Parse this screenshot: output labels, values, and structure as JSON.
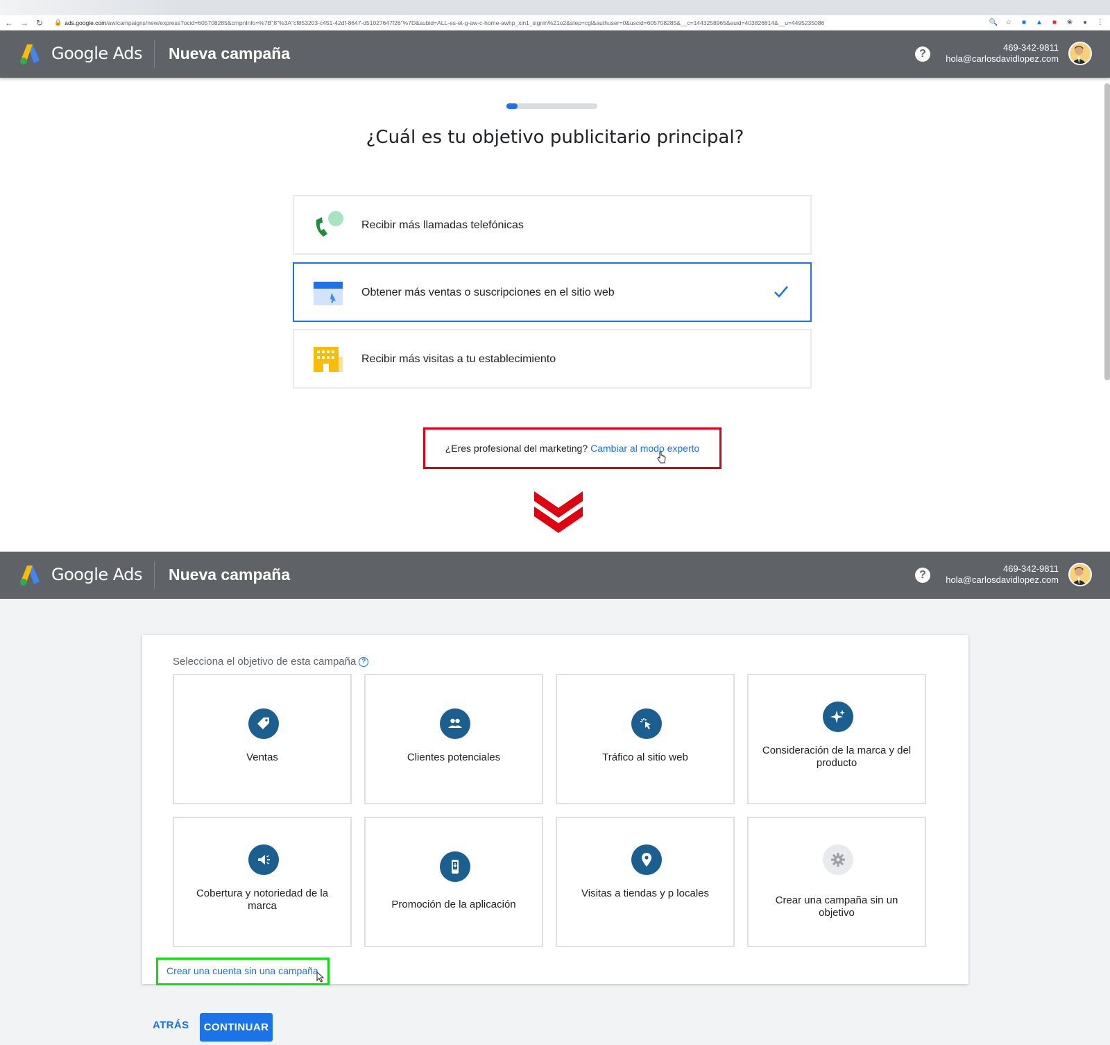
{
  "browser": {
    "url_host": "ads.google.com",
    "url_path": "/aw/campaigns/new/express?ocid=605708285&cmpnInfo=%7B\"8\"%3A\"cf853203-c451-42df-8647-d51027647f26\"%7D&subid=ALL-es-et-g-aw-c-home-awhp_xin1_signin%21o2&step=cgl&authuser=0&uscid=605708285&__c=1443258965&euid=403826814&__u=4495235086"
  },
  "header": {
    "brand": "Google Ads",
    "title": "Nueva campaña",
    "help_icon": "?",
    "phone": "469-342-9811",
    "email": "hola@carlosdavidlopez.com"
  },
  "express": {
    "progress_fraction": 0.12,
    "question": "¿Cuál es tu objetivo publicitario principal?",
    "options": [
      {
        "label": "Recibir más llamadas telefónicas",
        "icon": "phone-icon",
        "selected": false
      },
      {
        "label": "Obtener más ventas o suscripciones en el sitio web",
        "icon": "website-icon",
        "selected": true
      },
      {
        "label": "Recibir más visitas a tu establecimiento",
        "icon": "store-icon",
        "selected": false
      }
    ],
    "expert_question": "¿Eres profesional del marketing?",
    "expert_link": "Cambiar al modo experto"
  },
  "expert": {
    "panel_label": "Selecciona el objetivo de esta campaña",
    "objectives": [
      {
        "label": "Ventas",
        "icon": "tag-icon"
      },
      {
        "label": "Clientes potenciales",
        "icon": "people-icon"
      },
      {
        "label": "Tráfico al sitio web",
        "icon": "cursor-click-icon"
      },
      {
        "label": "Consideración de la marca y del producto",
        "icon": "sparkle-icon"
      },
      {
        "label": "Cobertura y notoriedad de la marca",
        "icon": "megaphone-icon"
      },
      {
        "label": "Promoción de la aplicación",
        "icon": "mobile-app-icon"
      },
      {
        "label": "Visitas a tiendas y p locales",
        "icon": "location-pin-icon"
      },
      {
        "label": "Crear una campaña sin un objetivo",
        "icon": "gear-icon"
      }
    ],
    "no_campaign_link": "Crear una cuenta sin una campaña",
    "back_label": "ATRÁS",
    "continue_label": "CONTINUAR"
  },
  "colors": {
    "header_bg": "#5f6368",
    "primary": "#1a73e8",
    "objective_icon_bg": "#1a5f8f",
    "highlight_red": "#e0000f",
    "highlight_green": "#12dd12"
  }
}
